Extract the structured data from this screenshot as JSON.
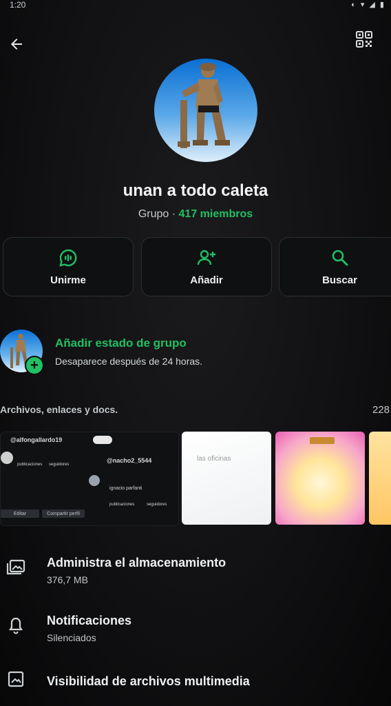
{
  "status_bar": {
    "time": "1:20",
    "icons": "◐ ▾ ◢ ▮"
  },
  "header": {
    "back_icon": "arrow-left-icon",
    "qr_icon": "qr-code-icon"
  },
  "profile": {
    "name": "unan a todo caleta",
    "type_label": "Grupo",
    "separator": " · ",
    "members": "417 miembros"
  },
  "actions": [
    {
      "label": "Unirme",
      "icon": "voice-chat-icon"
    },
    {
      "label": "Añadir",
      "icon": "add-person-icon"
    },
    {
      "label": "Buscar",
      "icon": "search-icon"
    }
  ],
  "group_status": {
    "title": "Añadir estado de grupo",
    "description": "Desaparece después de 24 horas."
  },
  "media": {
    "title": "Archivos, enlaces y docs.",
    "count": "228",
    "thumb_texts": {
      "user1": "@alfongallardo19",
      "user2": "@nacho2_5544",
      "name2": "ignacio parfanti",
      "pub": "publicaciones",
      "seg": "seguidores",
      "edit": "Editar",
      "share": "Compartir perfil",
      "white_text": "las oficinas"
    }
  },
  "settings": [
    {
      "title": "Administra el almacenamiento",
      "subtitle": "376,7 MB",
      "icon": "storage-folder-icon"
    },
    {
      "title": "Notificaciones",
      "subtitle": "Silenciados",
      "icon": "bell-icon"
    },
    {
      "title": "Visibilidad de archivos multimedia",
      "subtitle": "",
      "icon": "image-icon"
    }
  ],
  "colors": {
    "accent": "#21c063",
    "background": "#0b0b0c",
    "text": "#e9edef"
  }
}
